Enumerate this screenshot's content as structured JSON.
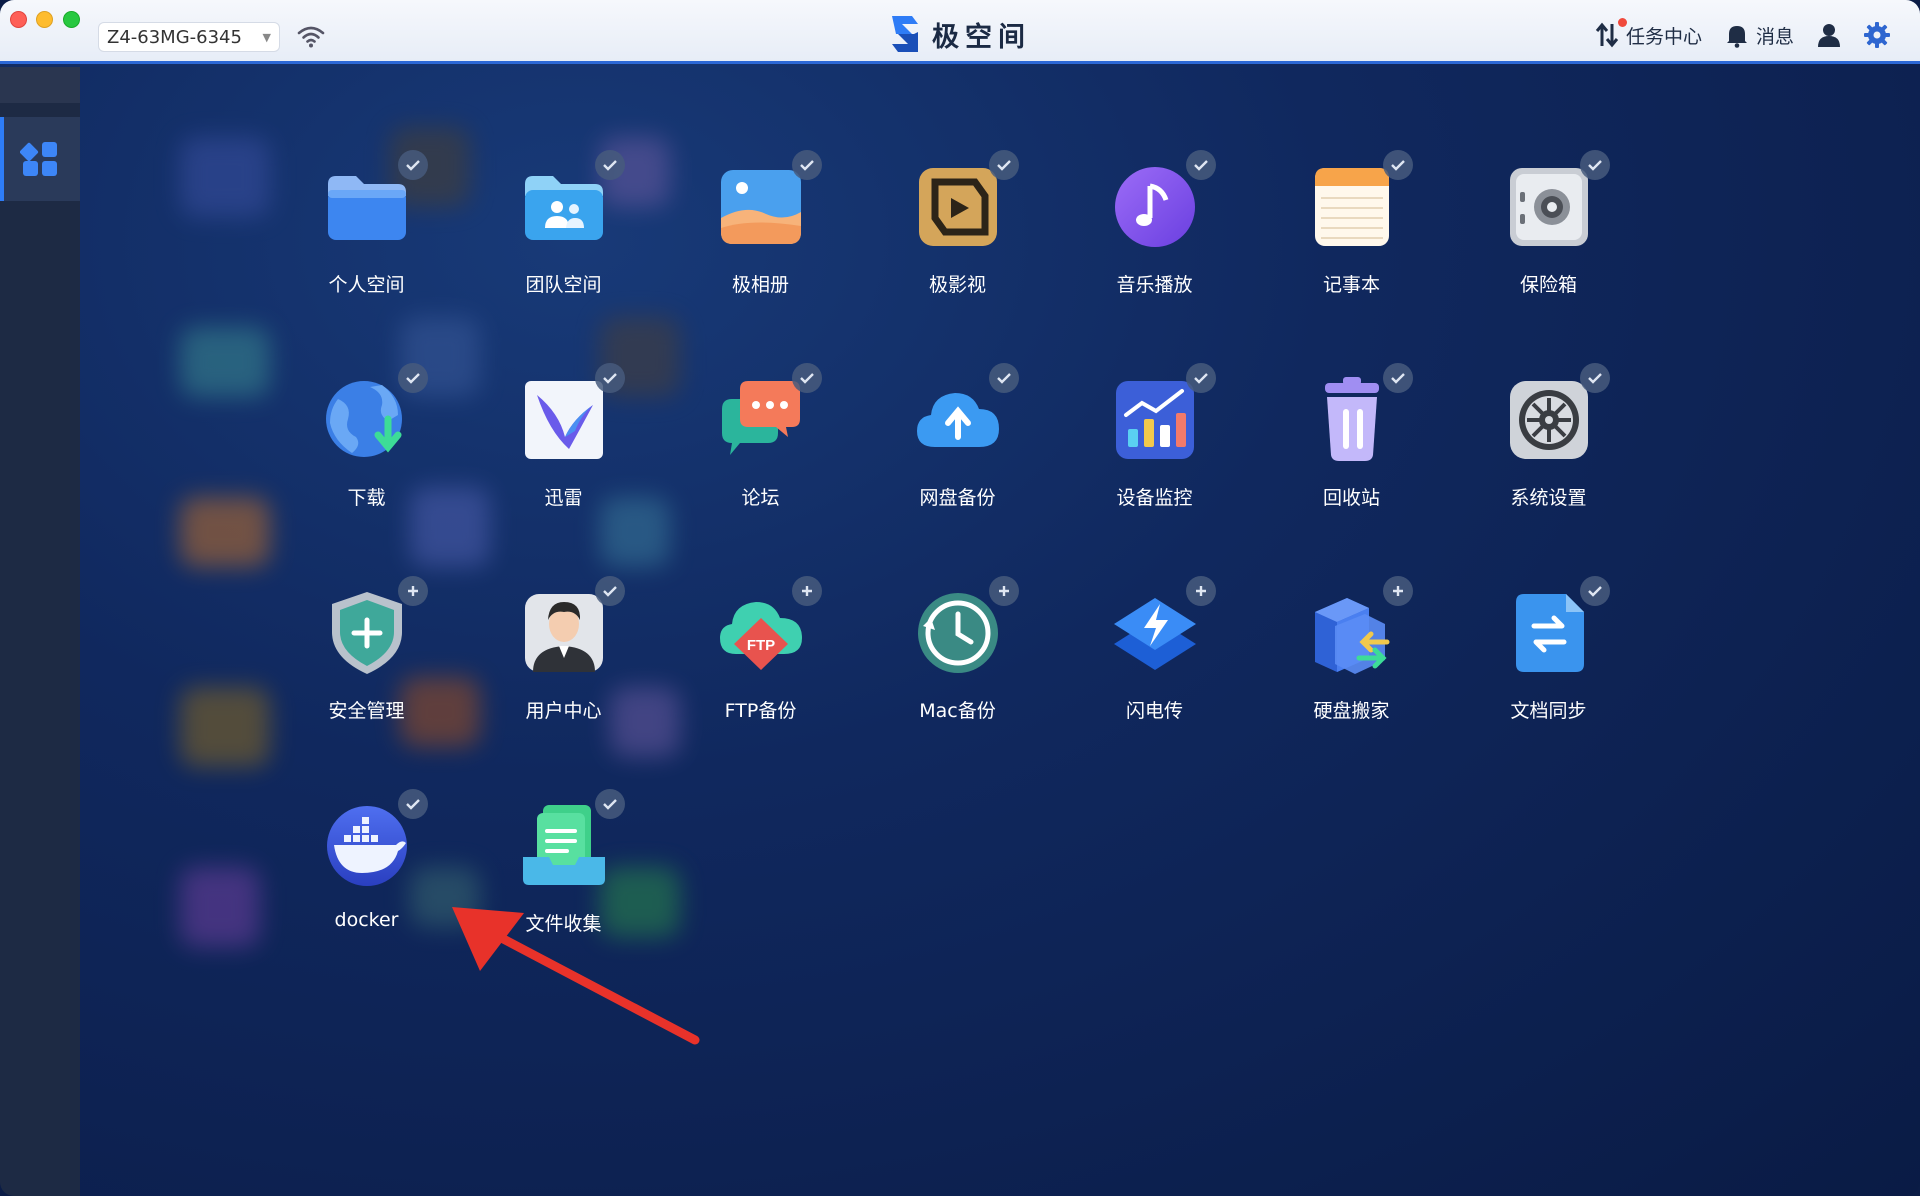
{
  "titlebar": {
    "device": "Z4-63MG-6345",
    "brand_name": "极空间",
    "task_center": "任务中心",
    "messages": "消息"
  },
  "apps": [
    {
      "label": "个人空间",
      "icon": "folder-icon"
    },
    {
      "label": "团队空间",
      "icon": "team-folder-icon"
    },
    {
      "label": "极相册",
      "icon": "photo-album-icon"
    },
    {
      "label": "极影视",
      "icon": "video-icon"
    },
    {
      "label": "音乐播放",
      "icon": "music-icon"
    },
    {
      "label": "记事本",
      "icon": "notepad-icon"
    },
    {
      "label": "保险箱",
      "icon": "safe-icon"
    },
    {
      "label": "下载",
      "icon": "download-globe-icon"
    },
    {
      "label": "迅雷",
      "icon": "xunlei-bird-icon"
    },
    {
      "label": "论坛",
      "icon": "forum-chat-icon"
    },
    {
      "label": "网盘备份",
      "icon": "cloud-upload-icon"
    },
    {
      "label": "设备监控",
      "icon": "monitor-chart-icon"
    },
    {
      "label": "回收站",
      "icon": "trash-icon"
    },
    {
      "label": "系统设置",
      "icon": "system-gear-icon"
    },
    {
      "label": "安全管理",
      "icon": "shield-icon"
    },
    {
      "label": "用户中心",
      "icon": "user-avatar-icon"
    },
    {
      "label": "FTP备份",
      "icon": "ftp-cloud-icon",
      "tile_text": "FTP"
    },
    {
      "label": "Mac备份",
      "icon": "clock-backup-icon"
    },
    {
      "label": "闪电传",
      "icon": "lightning-transfer-icon"
    },
    {
      "label": "硬盘搬家",
      "icon": "disk-move-icon"
    },
    {
      "label": "文档同步",
      "icon": "doc-sync-icon"
    },
    {
      "label": "docker",
      "icon": "docker-whale-icon"
    },
    {
      "label": "文件收集",
      "icon": "file-collect-icon"
    }
  ],
  "colors": {
    "accent": "#2e7cf6",
    "annotation_arrow": "#e8322a"
  }
}
